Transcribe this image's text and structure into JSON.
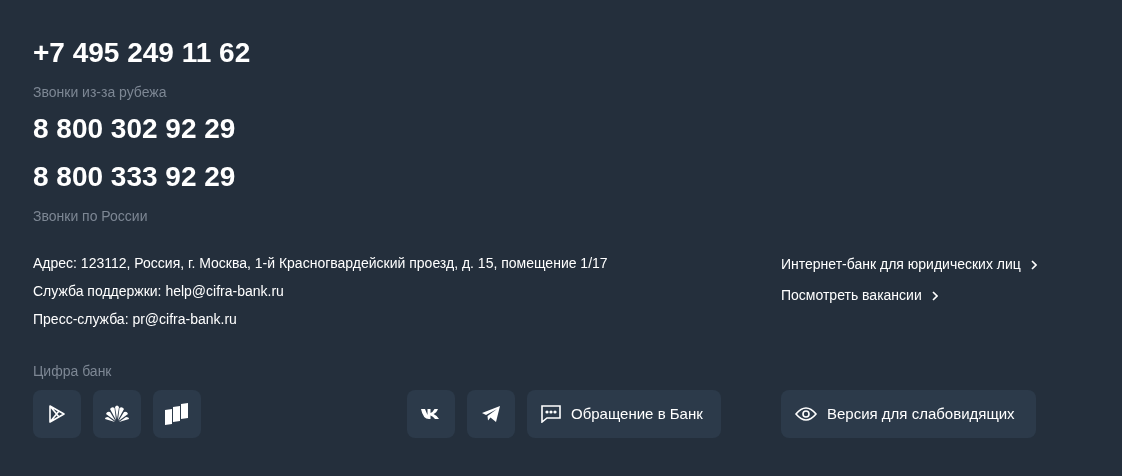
{
  "phones": [
    {
      "number": "+7 495 249 11 62",
      "caption": "Звонки из-за рубежа"
    },
    {
      "number": "8 800 302 92 29"
    },
    {
      "number": "8 800 333 92 29",
      "caption": "Звонки по России"
    }
  ],
  "contacts": [
    "Адрес: 123112, Россия, г. Москва, 1-й Красногвардейский проезд, д. 15, помещение 1/17",
    "Служба поддержки: help@cifra-bank.ru",
    "Пресс-служба: pr@cifra-bank.ru"
  ],
  "links": [
    "Интернет-банк для юридических лиц",
    "Посмотреть вакансии"
  ],
  "apps_caption": "Цифра банк",
  "app_buttons": [
    {
      "kind": "play"
    },
    {
      "kind": "huawei"
    },
    {
      "kind": "cards"
    }
  ],
  "social_buttons": [
    {
      "kind": "vk"
    },
    {
      "kind": "telegram"
    }
  ],
  "appeal_button": "Обращение в Банк",
  "accessibility_button": "Версия для слабовидящих"
}
